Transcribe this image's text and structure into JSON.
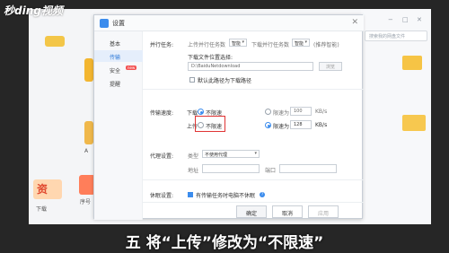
{
  "watermark": "秒ding视频",
  "background_app": {
    "left_labels": [
      "A",
      "序号",
      "下载"
    ],
    "left_promo": "资",
    "search_placeholder": "搜索我的网盘文件",
    "window_controls": [
      "−",
      "□",
      "✕"
    ]
  },
  "dialog": {
    "title": "设置",
    "close_label": "✕",
    "sidebar": [
      {
        "label": "基本",
        "active": false
      },
      {
        "label": "传输",
        "active": true
      },
      {
        "label": "安全",
        "active": false,
        "badge": "new"
      },
      {
        "label": "提醒",
        "active": false
      }
    ],
    "parallel": {
      "section_label": "并行任务:",
      "upload_label": "上传并行任务数",
      "upload_value": "智能",
      "download_label": "下载并行任务数",
      "download_value": "智能",
      "hint": "(推荐智能)"
    },
    "download_location": {
      "label": "下载文件位置选择:",
      "path": "D:\\BaiduNetdownload",
      "browse_label": "浏览",
      "default_checkbox_label": "默认此路径为下载路径",
      "default_checked": false
    },
    "speed": {
      "section_label": "传输速度:",
      "download_label": "下载",
      "upload_label": "上传",
      "unlimited_label": "不限速",
      "limit_label": "限速为",
      "unit": "KB/s",
      "download_limit_value": "100",
      "upload_limit_value": "128",
      "download_selected": "unlimited",
      "upload_selected": "limit"
    },
    "proxy": {
      "section_label": "代理设置:",
      "type_label": "类型",
      "type_value": "不使用代理",
      "address_label": "地址",
      "port_label": "端口"
    },
    "sleep": {
      "section_label": "休眠设置:",
      "checkbox_label": "有传输任务时电脑不休眠",
      "checked": true
    },
    "buttons": {
      "ok": "确定",
      "cancel": "取消",
      "apply": "应用"
    }
  },
  "caption": "五 将“上传”修改为“不限速”",
  "colors": {
    "accent": "#3b8ced",
    "highlight": "#e03434",
    "frame": "#262626"
  }
}
